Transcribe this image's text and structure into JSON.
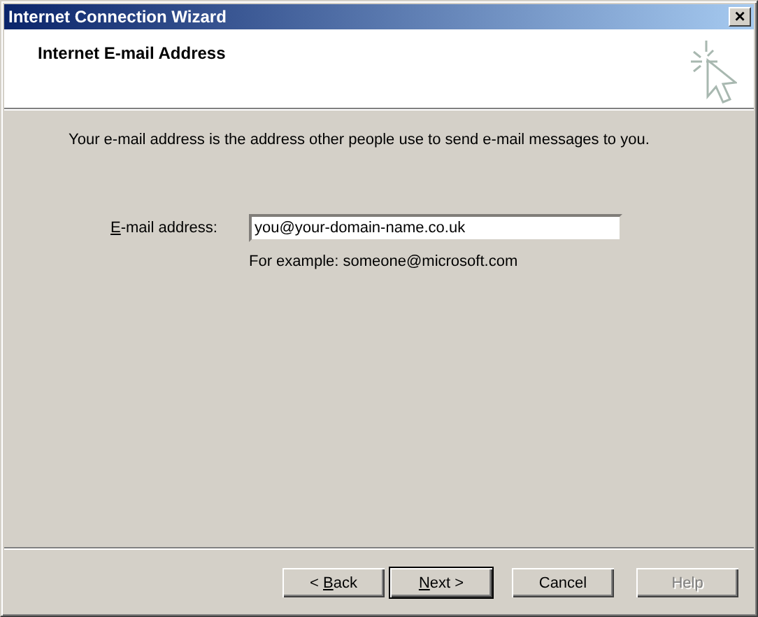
{
  "window": {
    "title": "Internet Connection Wizard",
    "close": "×"
  },
  "header": {
    "title": "Internet E-mail Address"
  },
  "intro": "Your e-mail address is the address other people use to send e-mail messages to you.",
  "email": {
    "label": {
      "key": "E",
      "after": "-mail address:"
    },
    "value": "you@your-domain-name.co.uk",
    "example": "For example: someone@microsoft.com"
  },
  "buttons": [
    {
      "before": "< ",
      "key": "B",
      "after": "ack",
      "default": false,
      "disabled": false
    },
    {
      "key": "N",
      "after": "ext >",
      "default": true,
      "disabled": false
    },
    {
      "before": "Cancel",
      "default": false,
      "disabled": false
    },
    {
      "before": "Help",
      "default": false,
      "disabled": true
    }
  ]
}
